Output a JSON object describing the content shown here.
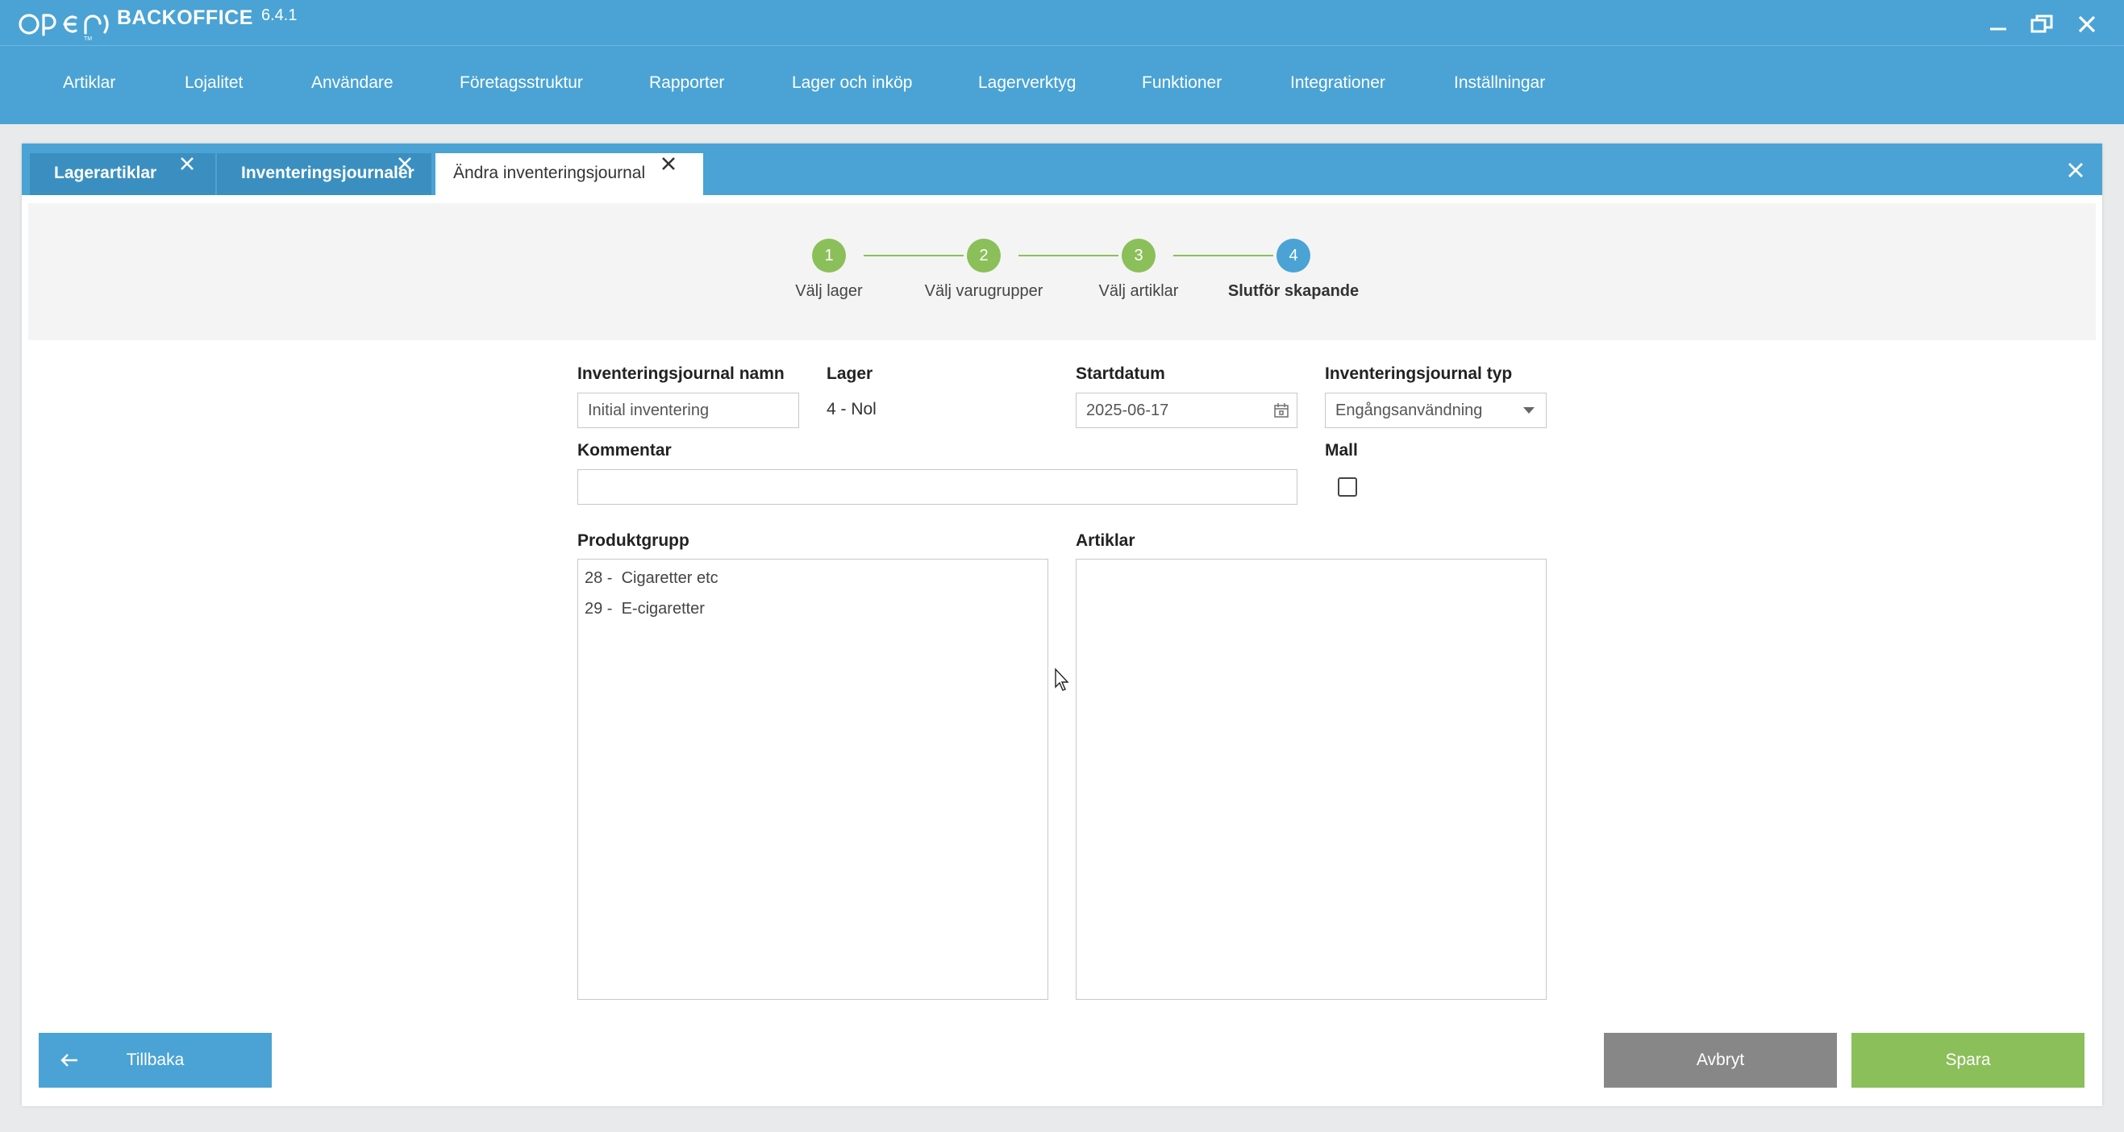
{
  "app": {
    "logo_text": "OPEN",
    "brand": "BACKOFFICE",
    "version": "6.4.1"
  },
  "window_controls": {
    "minimize": "minimize-icon",
    "restore": "restore-icon",
    "close": "close-icon"
  },
  "menu": [
    {
      "label": "Artiklar"
    },
    {
      "label": "Lojalitet"
    },
    {
      "label": "Användare"
    },
    {
      "label": "Företagsstruktur"
    },
    {
      "label": "Rapporter"
    },
    {
      "label": "Lager och inköp"
    },
    {
      "label": "Lagerverktyg"
    },
    {
      "label": "Funktioner"
    },
    {
      "label": "Integrationer"
    },
    {
      "label": "Inställningar"
    }
  ],
  "tabs": [
    {
      "label": "Lagerartiklar",
      "active": false
    },
    {
      "label": "Inventeringsjournaler",
      "active": false
    },
    {
      "label": "Ändra inventeringsjournal",
      "active": true
    }
  ],
  "stepper": {
    "steps": [
      {
        "number": "1",
        "label": "Välj lager",
        "state": "done"
      },
      {
        "number": "2",
        "label": "Välj varugrupper",
        "state": "done"
      },
      {
        "number": "3",
        "label": "Välj artiklar",
        "state": "done"
      },
      {
        "number": "4",
        "label": "Slutför skapande",
        "state": "current"
      }
    ],
    "colors": {
      "done": "#8bbf5a",
      "current": "#4aa3d4"
    }
  },
  "form": {
    "name_label": "Inventeringsjournal namn",
    "name_value": "Initial inventering",
    "lager_label": "Lager",
    "lager_value": "4 - Nol",
    "startdatum_label": "Startdatum",
    "startdatum_value": "2025-06-17",
    "typ_label": "Inventeringsjournal typ",
    "typ_value": "Engångsanvändning",
    "kommentar_label": "Kommentar",
    "kommentar_value": "",
    "mall_label": "Mall",
    "mall_checked": false,
    "produktgrupp_label": "Produktgrupp",
    "produktgrupp_items": [
      {
        "code": "28",
        "name": "Cigaretter etc"
      },
      {
        "code": "29",
        "name": "E-cigaretter"
      }
    ],
    "artiklar_label": "Artiklar",
    "artiklar_items": []
  },
  "buttons": {
    "back": "Tillbaka",
    "cancel": "Avbryt",
    "save": "Spara"
  },
  "colors": {
    "primary": "#4aa3d4",
    "tab_inactive": "#3a8fc0",
    "success": "#8bbf5a",
    "neutral": "#878787"
  }
}
